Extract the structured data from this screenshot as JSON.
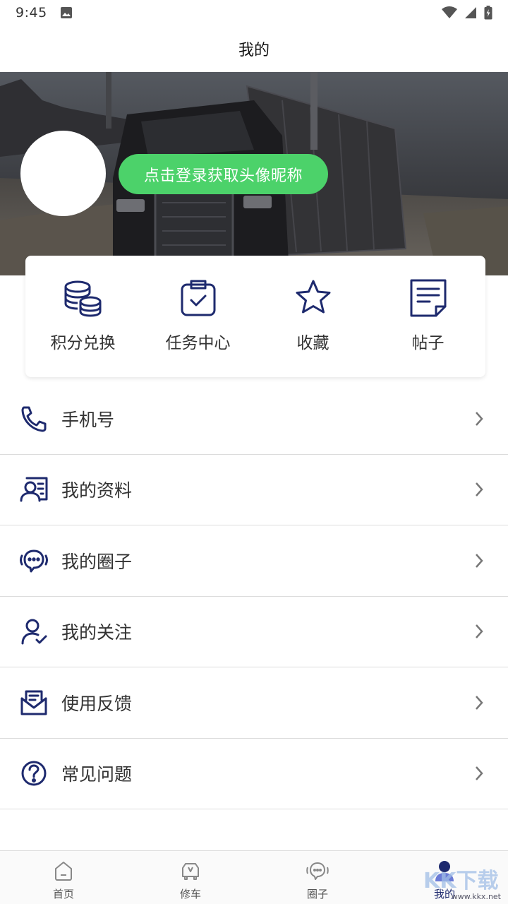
{
  "status_bar": {
    "time": "9:45",
    "icons": [
      "image-icon",
      "wifi-icon",
      "signal-icon",
      "battery-icon"
    ]
  },
  "header": {
    "title": "我的"
  },
  "profile": {
    "login_button": "点击登录获取头像昵称"
  },
  "quick_actions": [
    {
      "label": "积分兑换",
      "icon": "coins-icon"
    },
    {
      "label": "任务中心",
      "icon": "clipboard-check-icon"
    },
    {
      "label": "收藏",
      "icon": "star-icon"
    },
    {
      "label": "帖子",
      "icon": "document-icon"
    }
  ],
  "menu": [
    {
      "label": "手机号",
      "icon": "phone-icon"
    },
    {
      "label": "我的资料",
      "icon": "profile-card-icon"
    },
    {
      "label": "我的圈子",
      "icon": "chat-bubble-icon"
    },
    {
      "label": "我的关注",
      "icon": "user-check-icon"
    },
    {
      "label": "使用反馈",
      "icon": "mail-icon"
    },
    {
      "label": "常见问题",
      "icon": "question-icon"
    }
  ],
  "bottom_nav": [
    {
      "label": "首页",
      "icon": "home-icon"
    },
    {
      "label": "修车",
      "icon": "repair-icon"
    },
    {
      "label": "圈子",
      "icon": "circle-chat-icon"
    },
    {
      "label": "我的",
      "icon": "user-icon",
      "active": true
    }
  ],
  "watermark": {
    "big": "KK下载",
    "small": "www.kkx.net"
  },
  "colors": {
    "accent": "#1e2a6e",
    "login_green": "#4cd26a",
    "divider": "#dcdcdc"
  }
}
